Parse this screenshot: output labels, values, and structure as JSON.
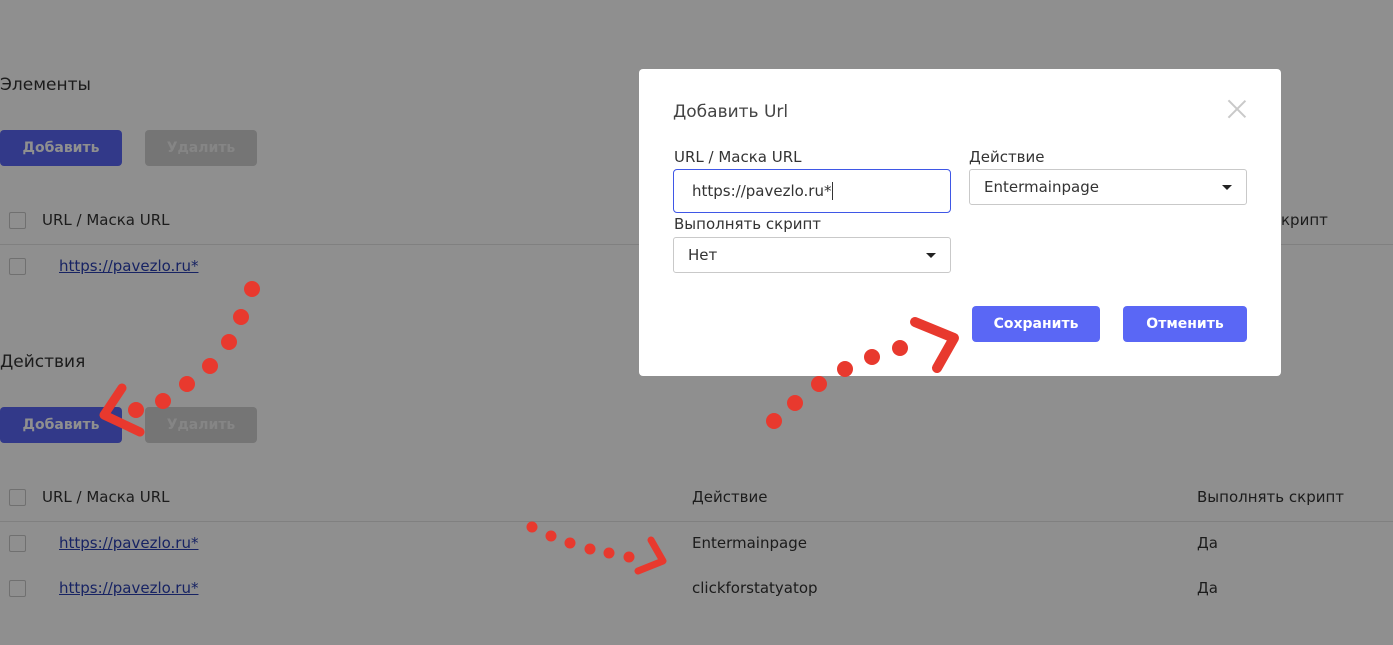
{
  "elements_section": {
    "title": "Элементы",
    "add_label": "Добавить",
    "delete_label": "Удалить",
    "header_url": "URL / Маска URL",
    "header_script_partial": "крипт",
    "rows": [
      {
        "url": "https://pavezlo.ru*"
      }
    ]
  },
  "actions_section": {
    "title": "Действия",
    "add_label": "Добавить",
    "delete_label": "Удалить",
    "header_url": "URL / Маска URL",
    "header_action": "Действие",
    "header_script": "Выполнять скрипт",
    "rows": [
      {
        "url": "https://pavezlo.ru*",
        "action": "Entermainpage",
        "script": "Да"
      },
      {
        "url": "https://pavezlo.ru*",
        "action": "clickforstatyatop",
        "script": "Да"
      }
    ]
  },
  "modal": {
    "title": "Добавить Url",
    "url_label": "URL / Маска URL",
    "url_value": "https://pavezlo.ru*",
    "action_label": "Действие",
    "action_value": "Entermainpage",
    "script_label": "Выполнять скрипт",
    "script_value": "Нет",
    "save_label": "Сохранить",
    "cancel_label": "Отменить"
  },
  "colors": {
    "primary": "#5a67f5",
    "overlay": "rgba(0,0,0,0.44)",
    "annotation": "#e8392e",
    "link": "#2a3fb0"
  }
}
